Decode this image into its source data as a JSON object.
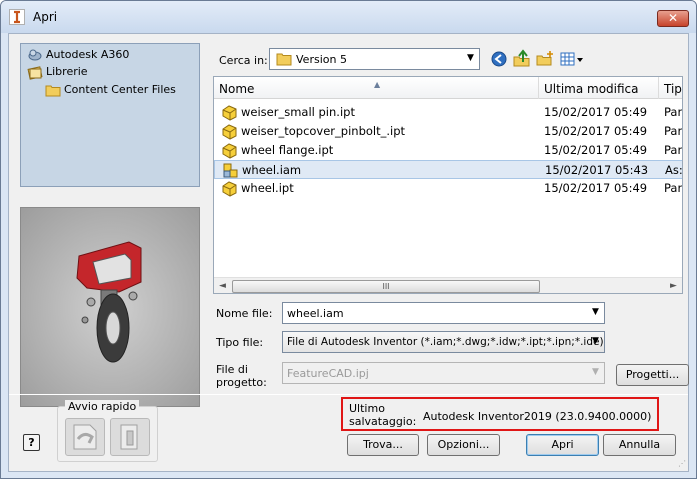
{
  "window": {
    "title": "Apri",
    "close_glyph": "✕"
  },
  "places": [
    {
      "label": "Autodesk A360",
      "icon": "a360-icon"
    },
    {
      "label": "Librerie",
      "icon": "libraries-icon"
    },
    {
      "label": "Content Center Files",
      "icon": "folder-icon"
    }
  ],
  "lookin": {
    "label": "Cerca in:",
    "value": "Version 5",
    "arrow": "▼"
  },
  "columns": {
    "name": "Nome",
    "modified": "Ultima modifica",
    "type": "Tip"
  },
  "files": [
    {
      "name": "weiser_small pin.ipt",
      "modified": "15/02/2017 05:49",
      "type": "Par",
      "icon": "part-icon",
      "selected": false
    },
    {
      "name": "weiser_topcover_pinbolt_.ipt",
      "modified": "15/02/2017 05:49",
      "type": "Par",
      "icon": "part-icon",
      "selected": false
    },
    {
      "name": "wheel flange.ipt",
      "modified": "15/02/2017 05:49",
      "type": "Par",
      "icon": "part-icon",
      "selected": false
    },
    {
      "name": "wheel.iam",
      "modified": "15/02/2017 05:43",
      "type": "As:",
      "icon": "assembly-icon",
      "selected": true
    },
    {
      "name": "wheel.ipt",
      "modified": "15/02/2017 05:49",
      "type": "Par",
      "icon": "part-icon",
      "selected": false
    }
  ],
  "scroll": {
    "left": "◄",
    "right": "►",
    "grip": "III"
  },
  "filename": {
    "label": "Nome file:",
    "value": "wheel.iam"
  },
  "filetype": {
    "label": "Tipo file:",
    "value": "File di Autodesk Inventor (*.iam;*.dwg;*.idw;*.ipt;*.ipn;*.ide)"
  },
  "project": {
    "label_line1": "File di",
    "label_line2": "progetto:",
    "value": "FeatureCAD.ipj",
    "button": "Progetti..."
  },
  "quick_launch": {
    "title": "Avvio rapido"
  },
  "last_saved": {
    "label_line1": "Ultimo",
    "label_line2": "salvataggio:",
    "value": "Autodesk Inventor2019 (23.0.9400.0000)"
  },
  "buttons": {
    "find": "Trova...",
    "options": "Opzioni...",
    "open": "Apri",
    "cancel": "Annulla",
    "help": "?"
  },
  "colors": {
    "highlight_border": "#e01616",
    "selection": "#dfe9f5",
    "wheel_red": "#c4262b"
  }
}
